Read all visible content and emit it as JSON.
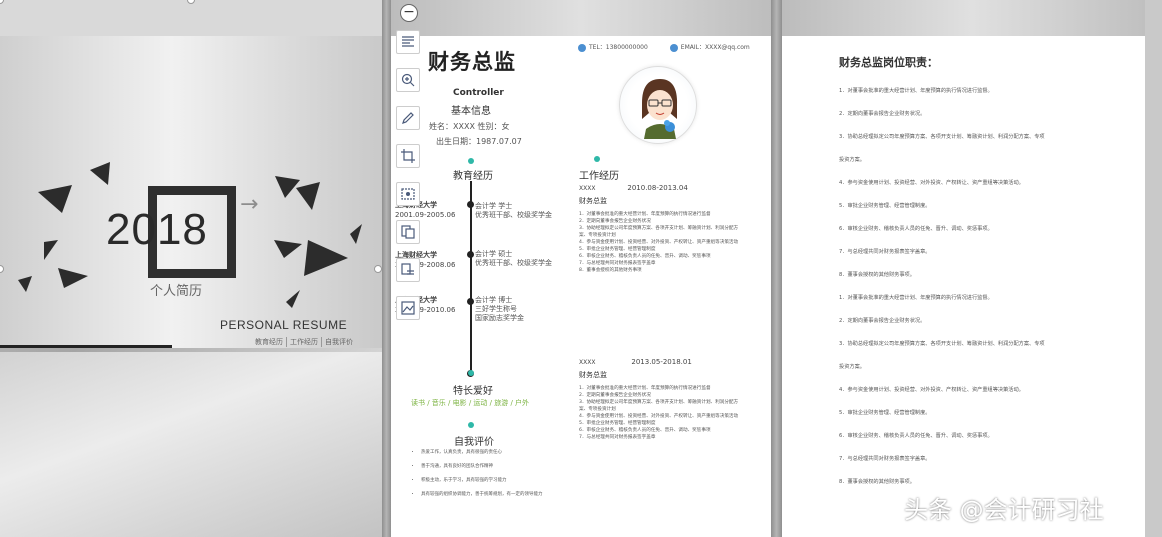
{
  "cover": {
    "year": "2018",
    "subtitle": "个人简历",
    "english_title": "PERSONAL  RESUME",
    "nav": [
      "教育经历",
      "工作经历",
      "自我评价"
    ]
  },
  "resume": {
    "title": "财务总监",
    "tel": "TEL：13800000000",
    "email": "EMAIL：XXXX@qq.com",
    "position_en": "Controller",
    "basic_info_label": "基本信息",
    "name_line": "姓名：XXXX        性别：女",
    "birth_line": "出生日期：1987.07.07",
    "education_label": "教育经历",
    "work_label": "工作经历",
    "education": [
      {
        "school": "上海财经大学",
        "years": "2001.09-2005.06",
        "degree": "会计学       学士",
        "honor": "优秀班干部、校级奖学金"
      },
      {
        "school": "上海财经大学",
        "years": "2005.09-2008.06",
        "degree": "会计学       硕士",
        "honor": "优秀班干部、校级奖学金"
      },
      {
        "school": "上海财经大学",
        "years": "2008.09-2010.06",
        "degree": "会计学       博士",
        "honor": "三好学生称号",
        "honor2": "国家励志奖学金"
      }
    ],
    "jobs": [
      {
        "company": "XXXX",
        "period": "2010.08-2013.04",
        "title": "财务总监",
        "items": [
          "1．对董事会批准的重大经营计划、年度预算的执行情况进行监督",
          "2．定期向董事会报告企业财务状况",
          "3．协助经理拟定公司年度预算方案、各项开支计划、筹融资计划、利润分配方案、专项投资计划",
          "4．参与资金使用计划、投资经营、对外投资、产权转让、资产重组等决策活动",
          "5．审批企业财务管理、经营管理制度",
          "6．审核企业财务、稽核负责人员的任免、晋升、调动、奖惩事项",
          "7．与总经理共同对财务报表签字盖章",
          "8．董事会授权的其他财务事项"
        ]
      },
      {
        "company": "XXXX",
        "period": "2013.05-2018.01",
        "title": "财务总监",
        "items": [
          "1．对董事会批准的重大经营计划、年度预算的执行情况进行监督",
          "2．定期向董事会报告企业财务状况",
          "3．协助经理拟定公司年度预算方案、各项开支计划、筹融资计划、利润分配方案、专项投资计划",
          "4．参与资金使用计划、投资经营、对外投资、产权转让、资产重组等决策活动",
          "5．审批企业财务管理、经营管理制度",
          "6．审核企业财务、稽核负责人员的任免、晋升、调动、奖惩事项",
          "7．与总经理共同对财务报表签字盖章"
        ]
      }
    ],
    "hobbies_label": "特长爱好",
    "hobbies": "读书 / 音乐 / 电影 / 运动 / 旅游 / 户外",
    "evaluation_label": "自我评价",
    "evaluation": [
      "热爱工作，认真负责，具有很强的责任心",
      "善于沟通，具有良好的团队合作精神",
      "积极主动，乐于学习，具有较强的学习能力",
      "具有较强的组织协调能力，善于统筹规划，有一定的领导能力"
    ]
  },
  "duties": {
    "title": "财务总监岗位职责：",
    "items": [
      "1．对董事会批准的重大经营计划、年度预算的执行情况进行监督。",
      "2．定期向董事会报告企业财务状况。",
      "3．协助总经理拟定公司年度预算方案、各项开支计划、筹融资计划、利润分配方案、专项",
      "投资方案。",
      "4．参与资金使用计划、投资经营、对外投资、产权转让、资产重组等决策活动。",
      "5．审批企业财务管理、经营管理制度。",
      "6．审核企业财务、稽核负责人员的任免、晋升、调动、奖惩事项。",
      "7．与总经理共同对财务报表签字盖章。",
      "8．董事会授权的其他财务事项。",
      "1．对董事会批准的重大经营计划、年度预算的执行情况进行监督。",
      "2．定期向董事会报告企业财务状况。",
      "3．协助总经理拟定公司年度预算方案、各项开支计划、筹融资计划、利润分配方案、专项",
      "投资方案。",
      "4．参与资金使用计划、投资经营、对外投资、产权转让、资产重组等决策活动。",
      "5．审批企业财务管理、经营管理制度。",
      "6．审核企业财务、稽核负责人员的任免、晋升、调动、奖惩事项。",
      "7．与总经理共同对财务报表签字盖章。",
      "8．董事会授权的其他财务事项。"
    ]
  },
  "toolbar": {
    "tools": [
      "text-wrap-icon",
      "zoom-in-icon",
      "edit-icon",
      "crop-icon",
      "picture-frame-icon",
      "replace-image-icon",
      "image-to-text-icon",
      "image-effects-icon"
    ]
  },
  "watermark": "头条 @会计研习社"
}
